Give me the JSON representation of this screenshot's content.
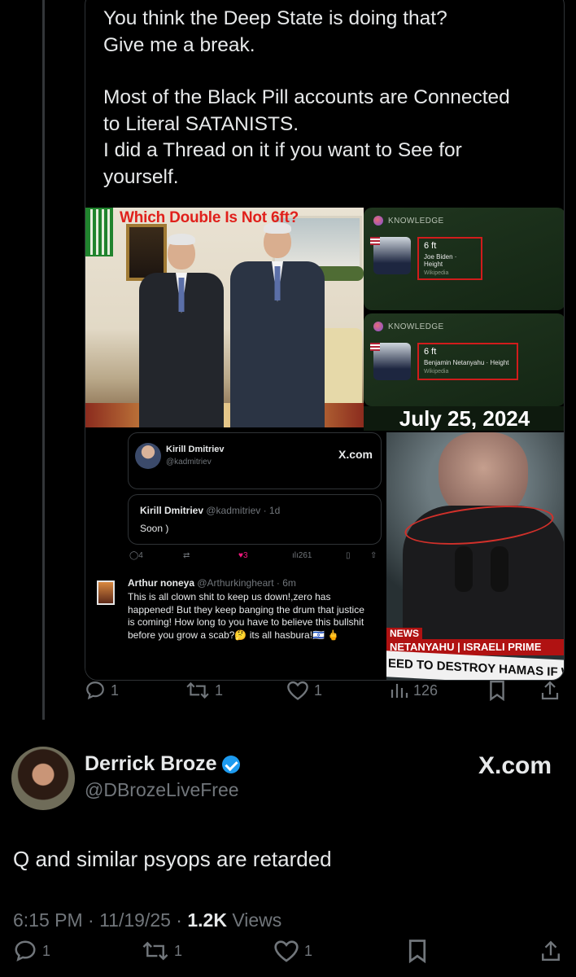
{
  "quoted": {
    "text_lines": [
      "You think the Deep State is doing that?\nGive me a break.",
      "Most of the Black Pill accounts are Connected\nto Literal SATANISTS.\nI did a Thread on it if you want to See for\nyourself."
    ],
    "media": {
      "photo_caption": "Which Double Is Not 6ft?",
      "knowledge_label": "KNOWLEDGE",
      "card1": {
        "value": "6 ft",
        "subject": "Joe Biden · Height",
        "source": "Wikipedia"
      },
      "card2": {
        "value": "6 ft",
        "subject": "Benjamin Netanyahu · Height",
        "source": "Wikipedia"
      },
      "date": "July 25, 2024",
      "embed": {
        "author_name": "Kirill Dmitriev",
        "author_handle": "@kadmitriev",
        "site": "X.com",
        "inner_name": "Kirill Dmitriev",
        "inner_handle_time": "@kadmitriev · 1d",
        "inner_text": "Soon )",
        "replies": "4",
        "likes": "3",
        "views": "261",
        "reply_name": "Arthur noneya",
        "reply_handle_time": "@Arthurkingheart · 6m",
        "reply_text": "This is all clown shit to keep us down!,zero has happened! But they keep banging the drum that justice is coming! How long to you have to believe this bullshit before you grow a scab?🤔 its all hasbura!🇮🇱 🖕"
      },
      "news": {
        "tag": "NEWS",
        "lower_third": "NETANYAHU | ISRAELI PRIME",
        "ticker": "EED TO DESTROY HAMAS IF WE W"
      }
    },
    "actions": {
      "replies": "1",
      "reposts": "1",
      "likes": "1",
      "views": "126"
    }
  },
  "main": {
    "name": "Derrick Broze",
    "handle": "@DBrozeLiveFree",
    "site": "X.com",
    "text": "Q and similar psyops are retarded",
    "time": "6:15 PM · 11/19/25 · ",
    "views_count": "1.2K",
    "views_label": " Views",
    "actions": {
      "replies": "1",
      "reposts": "1",
      "likes": "1"
    }
  },
  "colors": {
    "bg": "#000000",
    "text": "#e7e9ea",
    "muted": "#71767b",
    "verified": "#1d9bf0",
    "like": "#f91880"
  }
}
